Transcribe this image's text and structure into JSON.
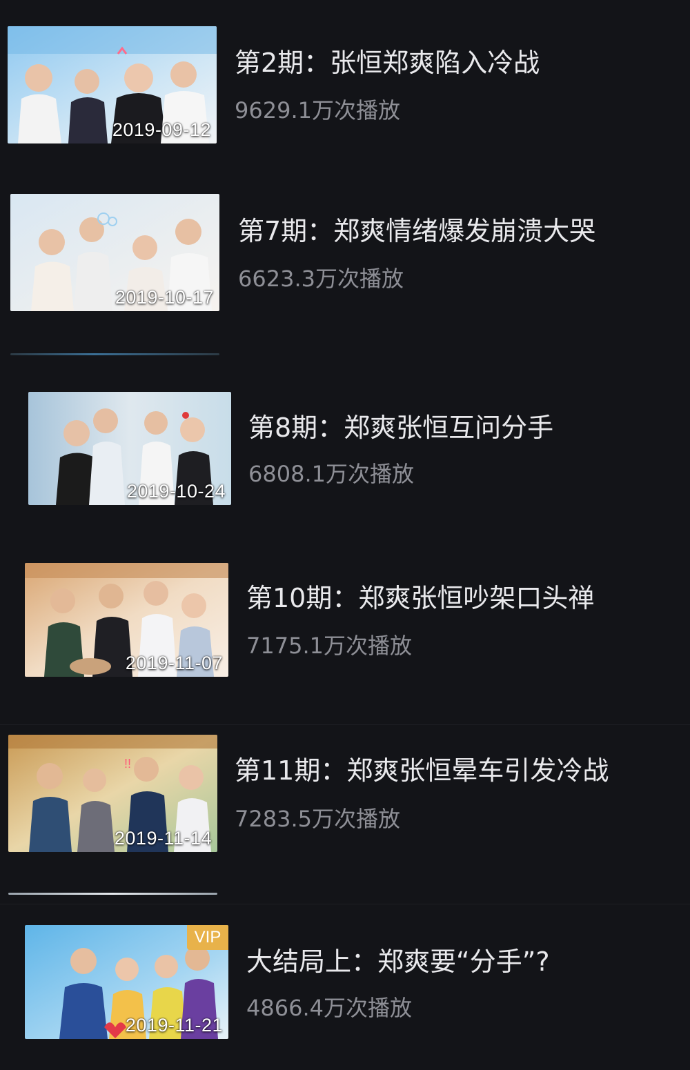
{
  "episodes": [
    {
      "title": "第2期：张恒郑爽陷入冷战",
      "plays": "9629.1万次播放",
      "date": "2019-09-12",
      "vip": ""
    },
    {
      "title": "第7期：郑爽情绪爆发崩溃大哭",
      "plays": "6623.3万次播放",
      "date": "2019-10-17",
      "vip": ""
    },
    {
      "title": "第8期：郑爽张恒互问分手",
      "plays": "6808.1万次播放",
      "date": "2019-10-24",
      "vip": ""
    },
    {
      "title": "第10期：郑爽张恒吵架口头禅",
      "plays": "7175.1万次播放",
      "date": "2019-11-07",
      "vip": ""
    },
    {
      "title": "第11期：郑爽张恒晕车引发冷战",
      "plays": "7283.5万次播放",
      "date": "2019-11-14",
      "vip": ""
    },
    {
      "title": "大结局上：郑爽要“分手”?",
      "plays": "4866.4万次播放",
      "date": "2019-11-21",
      "vip": "VIP"
    }
  ],
  "colors": {
    "background": "#131418",
    "title_text": "#e9e9ec",
    "plays_text": "#8e8f96",
    "vip_badge": "#e8b24a"
  }
}
